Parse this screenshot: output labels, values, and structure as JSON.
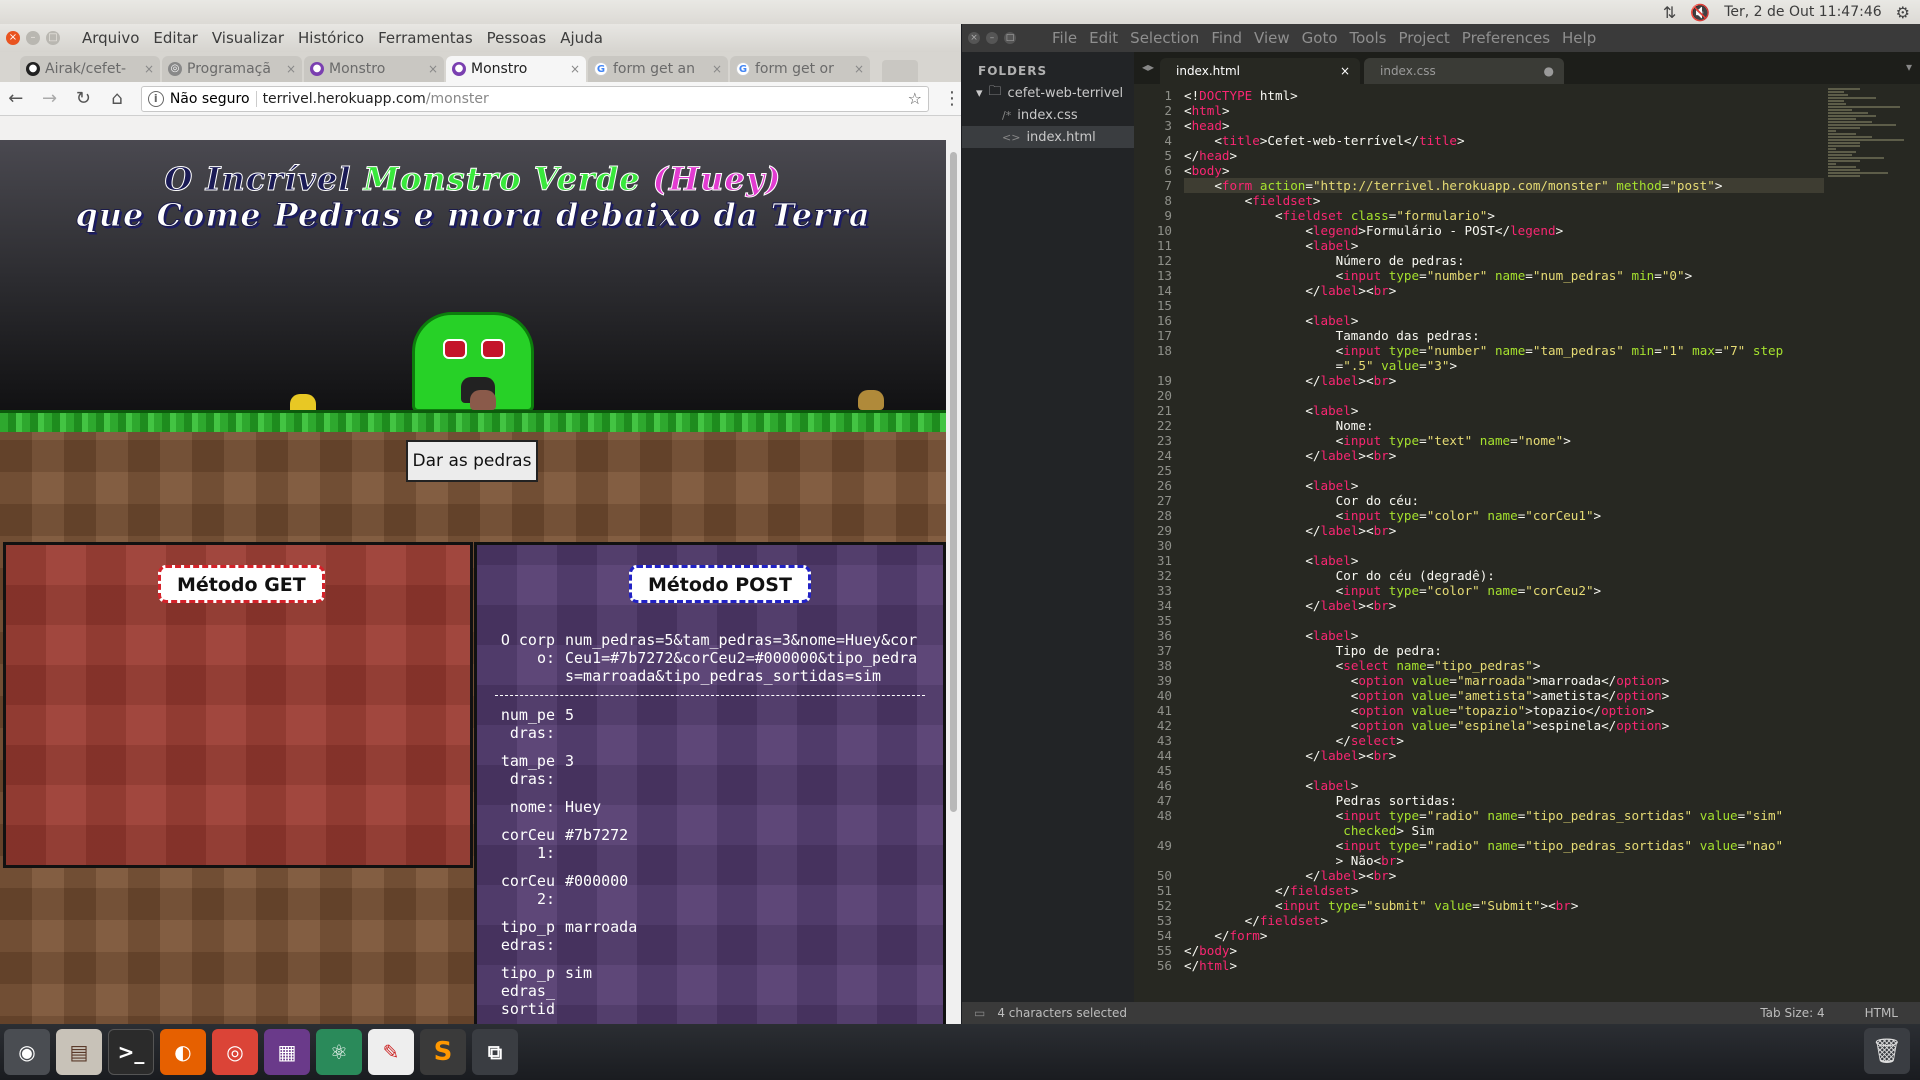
{
  "panel": {
    "datetime": "Ter, 2 de Out 11:47:46"
  },
  "browser": {
    "menu": [
      "Arquivo",
      "Editar",
      "Visualizar",
      "Histórico",
      "Ferramentas",
      "Pessoas",
      "Ajuda"
    ],
    "tabs": [
      {
        "label": "Airak/cefet-"
      },
      {
        "label": "Programaçã"
      },
      {
        "label": "Monstro"
      },
      {
        "label": "Monstro"
      },
      {
        "label": "form get an"
      },
      {
        "label": "form get or"
      }
    ],
    "omnibox": {
      "security": "Não seguro",
      "host": "terrivel.herokuapp.com",
      "path": "/monster"
    },
    "page": {
      "title_line1": {
        "a": "O Incrível",
        "b": "Monstro Verde",
        "c": "(Huey)"
      },
      "title_line2": "que Come Pedras e mora debaixo da Terra",
      "button": "Dar as pedras",
      "get_title": "Método GET",
      "post_title": "Método POST",
      "post": [
        {
          "k": "O corpo:",
          "v": "num_pedras=5&tam_pedras=3&nome=Huey&corCeu1=#7b7272&corCeu2=#000000&tipo_pedras=marroada&tipo_pedras_sortidas=sim"
        },
        {
          "k": "num_pedras:",
          "v": "5"
        },
        {
          "k": "tam_pedras:",
          "v": "3"
        },
        {
          "k": "nome:",
          "v": "Huey"
        },
        {
          "k": "corCeu1:",
          "v": "#7b7272"
        },
        {
          "k": "corCeu2:",
          "v": "#000000"
        },
        {
          "k": "tipo_pedras:",
          "v": "marroada"
        },
        {
          "k": "tipo_pedras_sortid",
          "v": "sim"
        }
      ]
    }
  },
  "sublime": {
    "menu": [
      "File",
      "Edit",
      "Selection",
      "Find",
      "View",
      "Goto",
      "Tools",
      "Project",
      "Preferences",
      "Help"
    ],
    "sidebar": {
      "heading": "FOLDERS",
      "folder": "cefet-web-terrivel",
      "files": [
        "index.css",
        "index.html"
      ]
    },
    "tabs": [
      "index.html",
      "index.css"
    ],
    "status": {
      "left": "4 characters selected",
      "tab_size": "Tab Size: 4",
      "syntax": "HTML"
    }
  },
  "colors": {
    "accent": "#e95420",
    "monster": "#27d127",
    "get_panel": "#9a3a30",
    "post_panel": "#523a6e",
    "sublime_bg": "#272822"
  }
}
